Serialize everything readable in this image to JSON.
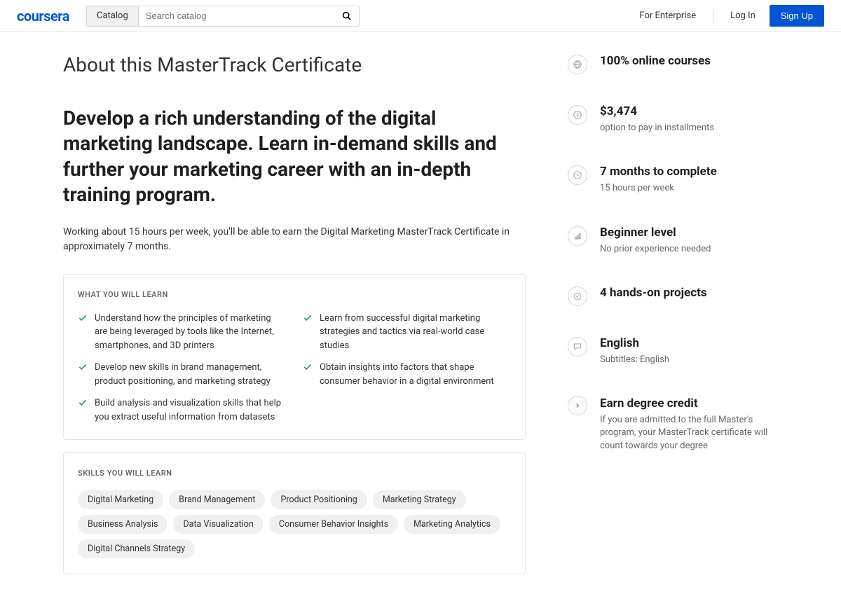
{
  "header": {
    "logo": "coursera",
    "catalog_label": "Catalog",
    "search_placeholder": "Search catalog",
    "for_enterprise": "For Enterprise",
    "login": "Log In",
    "signup": "Sign Up"
  },
  "page_title": "About this MasterTrack Certificate",
  "headline": "Develop a rich understanding of the digital marketing landscape. Learn in-demand skills and further your marketing career with an in-depth training program.",
  "subtext": "Working about 15 hours per week, you'll be able to earn the Digital Marketing MasterTrack Certificate in approximately 7 months.",
  "learn_title": "WHAT YOU WILL LEARN",
  "learn_items": [
    "Understand how the principles of marketing are being leveraged by tools like the Internet, smartphones, and 3D printers",
    "Learn from successful digital marketing strategies and tactics via real-world case studies",
    "Develop new skills in brand management, product positioning, and marketing strategy",
    "Obtain insights into factors that shape consumer behavior in a digital environment",
    "Build analysis and visualization skills that help you extract useful information from datasets"
  ],
  "skills_title": "SKILLS YOU WILL LEARN",
  "skills": [
    "Digital Marketing",
    "Brand Management",
    "Product Positioning",
    "Marketing Strategy",
    "Business Analysis",
    "Data Visualization",
    "Consumer Behavior Insights",
    "Marketing Analytics",
    "Digital Channels Strategy"
  ],
  "features": [
    {
      "title": "100% online courses",
      "sub": ""
    },
    {
      "title": "$3,474",
      "sub": "option to pay in installments"
    },
    {
      "title": "7 months to complete",
      "sub": "15 hours per week"
    },
    {
      "title": "Beginner level",
      "sub": "No prior experience needed"
    },
    {
      "title": "4 hands-on projects",
      "sub": ""
    },
    {
      "title": "English",
      "sub": "Subtitles: English"
    },
    {
      "title": "Earn degree credit",
      "sub": "If you are admitted to the full Master's program, your MasterTrack certificate will count towards your degree"
    }
  ]
}
